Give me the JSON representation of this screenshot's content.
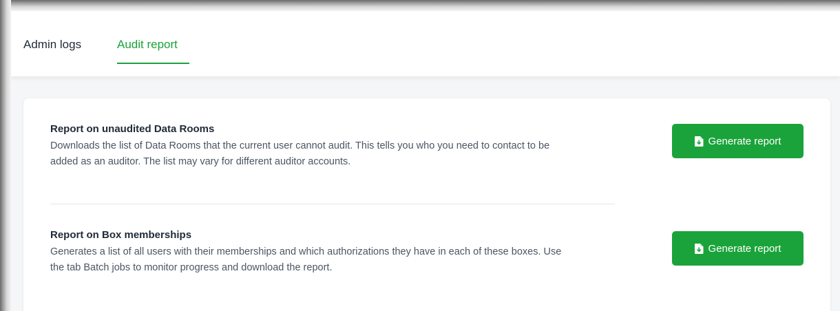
{
  "tabs": [
    {
      "label": "Admin logs",
      "active": false
    },
    {
      "label": "Audit report",
      "active": true
    }
  ],
  "colors": {
    "accent": "#1aa33a",
    "text": "#1f2a37",
    "muted": "#4b5563"
  },
  "reports": [
    {
      "title": "Report on unaudited Data Rooms",
      "description": "Downloads the list of Data Rooms that the current user cannot audit. This tells you who you need to contact to be added as an auditor. The list may vary for different auditor accounts.",
      "button_label": "Generate report",
      "button_icon": "file-download-icon"
    },
    {
      "title": "Report on Box memberships",
      "description": "Generates a list of all users with their memberships and which authorizations they have in each of these boxes. Use the tab Batch jobs to monitor progress and download the report.",
      "button_label": "Generate report",
      "button_icon": "file-download-icon"
    }
  ]
}
